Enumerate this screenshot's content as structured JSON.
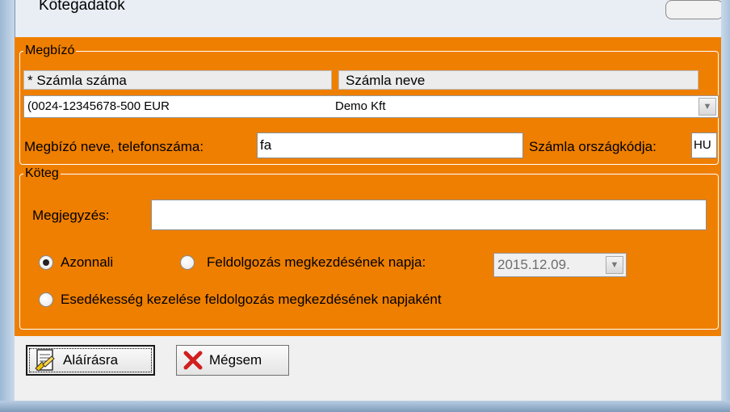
{
  "window": {
    "title": "Kötegadatok"
  },
  "megbizo": {
    "legend": "Megbízó",
    "col_account_number": "* Számla száma",
    "col_account_name": "Számla neve",
    "account_number": "(0024-12345678-500 EUR",
    "account_name": "Demo Kft",
    "client_label": "Megbízó neve, telefonszáma:",
    "client_value": "fa",
    "country_label": "Számla országkódja:",
    "country_value": "HU"
  },
  "koteg": {
    "legend": "Köteg",
    "note_label": "Megjegyzés:",
    "note_value": "",
    "radio_immediate": "Azonnali",
    "radio_processing_date": "Feldolgozás megkezdésének napja:",
    "date_value": "2015.12.09.",
    "radio_due_date": "Esedékesség kezelése feldolgozás megkezdésének napjaként",
    "selected": "Azonnali"
  },
  "buttons": {
    "sign_label": "Aláírásra",
    "cancel_label": "Mégsem"
  },
  "colors": {
    "panel": "#ef7f00",
    "cancel_x": "#d11f1f"
  }
}
